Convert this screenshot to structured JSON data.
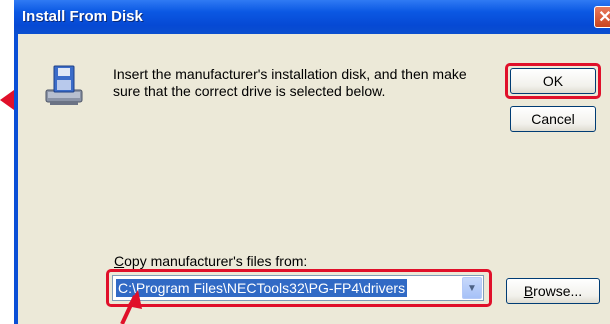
{
  "window": {
    "title": "Install From Disk",
    "close_glyph": "✕"
  },
  "dialog": {
    "icon": "floppy-disk-drive-icon",
    "message": "Insert the manufacturer's installation disk, and then make sure that the correct drive is selected below.",
    "ok_label": "OK",
    "cancel_label": "Cancel",
    "copy_label_underlined": "C",
    "copy_label_rest": "opy manufacturer's files from:",
    "path_value": "C:\\Program Files\\NECTools32\\PG-FP4\\drivers",
    "browse_label_underlined": "B",
    "browse_label_rest": "rowse..."
  },
  "annotations": {
    "highlight_color": "#e0102a",
    "arrow_icons": [
      "red-arrow-icon",
      "red-arrow-icon"
    ]
  }
}
